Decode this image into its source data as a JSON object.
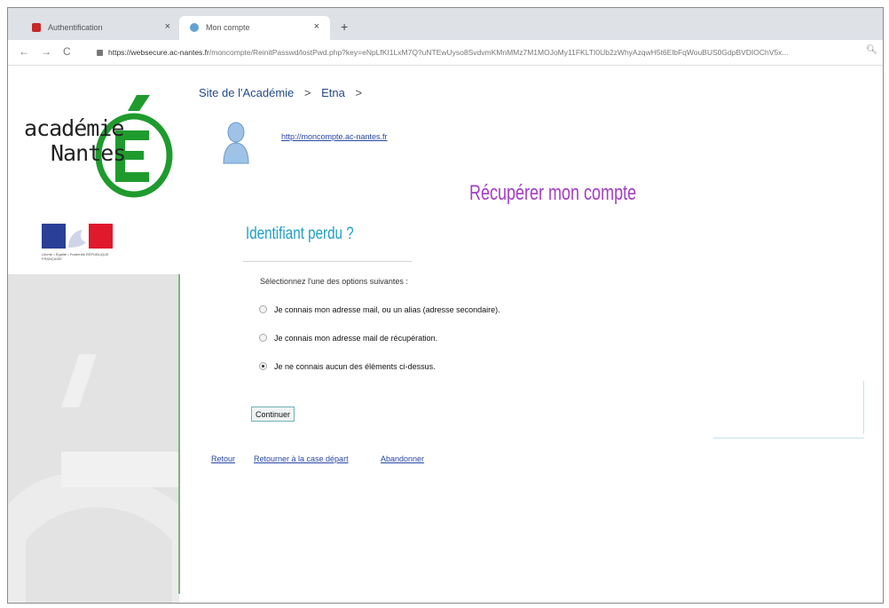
{
  "browser": {
    "tabs": [
      {
        "title": "Authentification",
        "close": "×"
      },
      {
        "title": "Mon compte",
        "close": "×"
      }
    ],
    "new_tab": "+",
    "nav": {
      "back": "←",
      "forward": "→",
      "reload": "C"
    },
    "url_host": "https://websecure.ac-nantes.fr",
    "url_path": "/moncompte/ReinitPasswd/lostPwd.php?key=eNpLfKI1LxM7Q?uNTEwUyso8SvdvmKMnMMz7M1MOJoMy11FKLTI0Ub2zWhyAzqwH5t6ElbFqWouBUS0GdpBVDIOChV5x..."
  },
  "logo": {
    "line1": "académie",
    "line2": "Nantes",
    "letter": "É",
    "flag_caption": "Liberté • Égalité • Fraternité RÉPUBLIQUE FRANÇAISE"
  },
  "breadcrumb": {
    "item1": "Site de l'Académie",
    "item2": "Etna",
    "sep": ">"
  },
  "user_link": "http://moncompte.ac-nantes.fr",
  "main_title": "Récupérer mon compte",
  "section_title": "Identifiant perdu ?",
  "form": {
    "instruction": "Sélectionnez l'une des options suivantes :",
    "options": [
      {
        "label": "Je connais mon adresse mail, ou un alias (adresse secondaire).",
        "checked": false
      },
      {
        "label": "Je connais mon adresse mail de récupération.",
        "checked": false
      },
      {
        "label": "Je ne connais aucun des éléments ci-dessus.",
        "checked": true
      }
    ],
    "submit_label": "Continuer"
  },
  "footer": {
    "back": "Retour",
    "restart": "Retourner à la case départ",
    "abort": "Abandonner"
  },
  "colors": {
    "title": "#a43ec4",
    "section": "#1f9fc6",
    "logo_green": "#1f9b2e",
    "link": "#2847a6"
  }
}
